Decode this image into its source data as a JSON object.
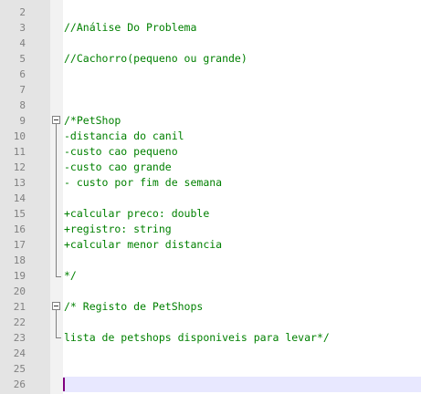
{
  "editor": {
    "lines": [
      {
        "num": "2",
        "text": ""
      },
      {
        "num": "3",
        "text": "//Análise Do Problema"
      },
      {
        "num": "4",
        "text": ""
      },
      {
        "num": "5",
        "text": "//Cachorro(pequeno ou grande)"
      },
      {
        "num": "6",
        "text": ""
      },
      {
        "num": "7",
        "text": ""
      },
      {
        "num": "8",
        "text": ""
      },
      {
        "num": "9",
        "text": "/*PetShop"
      },
      {
        "num": "10",
        "text": "-distancia do canil"
      },
      {
        "num": "11",
        "text": "-custo cao pequeno"
      },
      {
        "num": "12",
        "text": "-custo cao grande"
      },
      {
        "num": "13",
        "text": "- custo por fim de semana"
      },
      {
        "num": "14",
        "text": ""
      },
      {
        "num": "15",
        "text": "+calcular preco: double"
      },
      {
        "num": "16",
        "text": "+registro: string"
      },
      {
        "num": "17",
        "text": "+calcular menor distancia"
      },
      {
        "num": "18",
        "text": ""
      },
      {
        "num": "19",
        "text": "*/"
      },
      {
        "num": "20",
        "text": ""
      },
      {
        "num": "21",
        "text": "/* Registo de PetShops"
      },
      {
        "num": "22",
        "text": ""
      },
      {
        "num": "23",
        "text": "lista de petshops disponiveis para levar*/"
      },
      {
        "num": "24",
        "text": ""
      },
      {
        "num": "25",
        "text": ""
      },
      {
        "num": "26",
        "text": ""
      }
    ],
    "colors": {
      "comment": "#008000",
      "line_number": "#808080",
      "gutter_bg": "#e4e4e4",
      "current_line_bg": "#e8e8ff",
      "caret": "#800080"
    }
  }
}
